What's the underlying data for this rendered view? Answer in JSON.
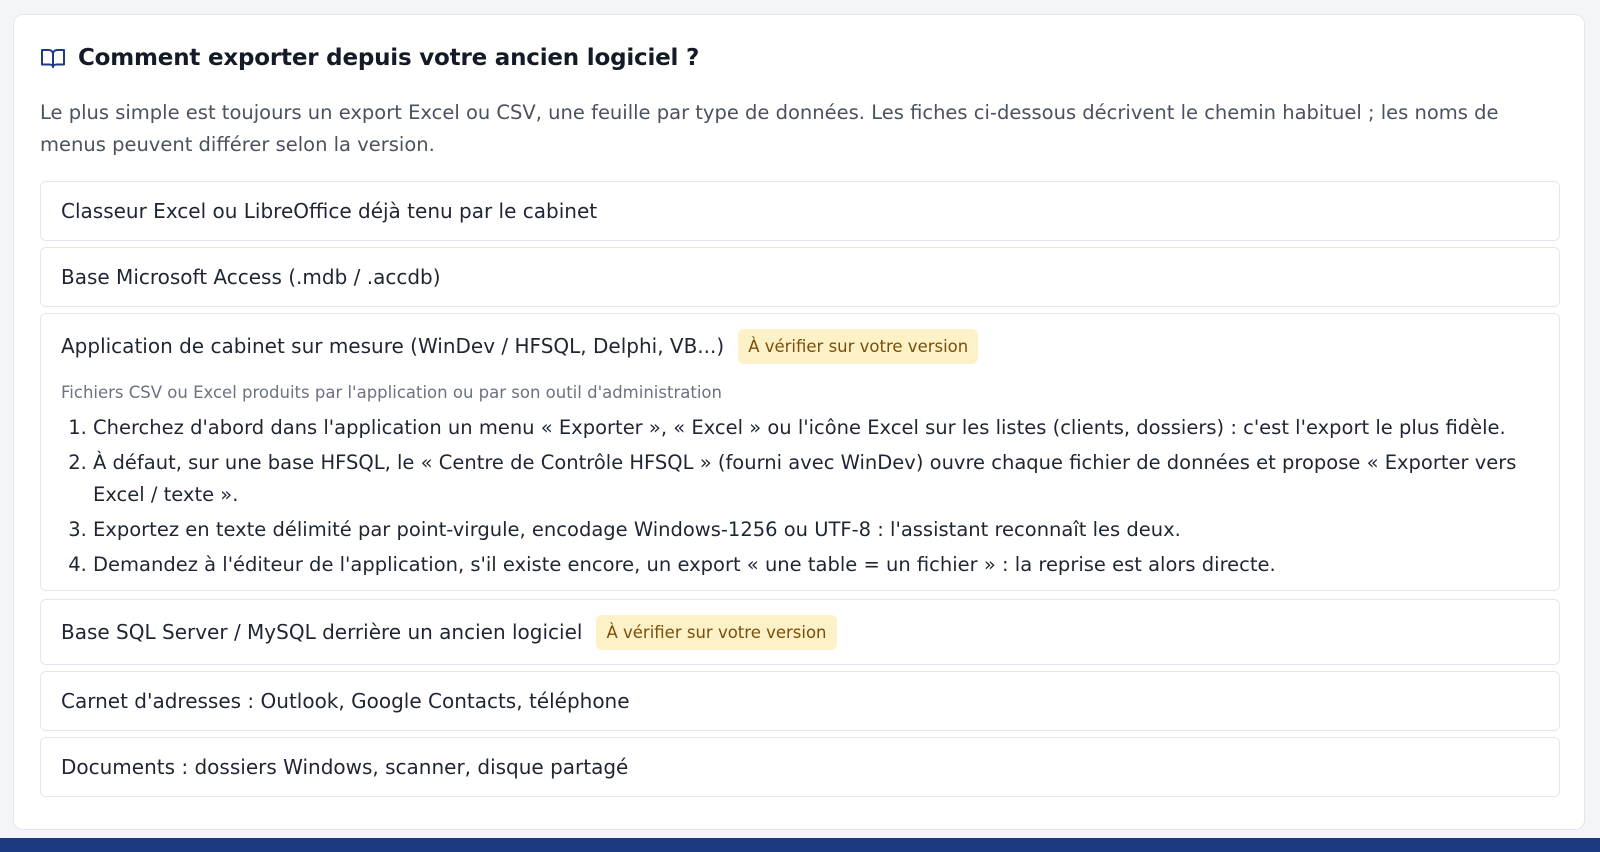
{
  "header": {
    "icon": "book-open-icon",
    "title": "Comment exporter depuis votre ancien logiciel ?"
  },
  "intro": "Le plus simple est toujours un export Excel ou CSV, une feuille par type de données. Les fiches ci-dessous décrivent le chemin habituel ; les noms de menus peuvent différer selon la version.",
  "accordion": [
    {
      "title": "Classeur Excel ou LibreOffice déjà tenu par le cabinet"
    },
    {
      "title": "Base Microsoft Access (.mdb / .accdb)"
    },
    {
      "title": "Application de cabinet sur mesure (WinDev / HFSQL, Delphi, VB...)",
      "badge": "À vérifier sur votre version",
      "subtitle": "Fichiers CSV ou Excel produits par l'application ou par son outil d'administration",
      "steps": [
        "Cherchez d'abord dans l'application un menu « Exporter », « Excel » ou l'icône Excel sur les listes (clients, dossiers) : c'est l'export le plus fidèle.",
        "À défaut, sur une base HFSQL, le « Centre de Contrôle HFSQL » (fourni avec WinDev) ouvre chaque fichier de données et propose « Exporter vers Excel / texte ».",
        "Exportez en texte délimité par point-virgule, encodage Windows-1256 ou UTF-8 : l'assistant reconnaît les deux.",
        "Demandez à l'éditeur de l'application, s'il existe encore, un export « une table = un fichier » : la reprise est alors directe."
      ]
    },
    {
      "title": "Base SQL Server / MySQL derrière un ancien logiciel",
      "badge": "À vérifier sur votre version"
    },
    {
      "title": "Carnet d'adresses : Outlook, Google Contacts, téléphone"
    },
    {
      "title": "Documents : dossiers Windows, scanner, disque partagé"
    }
  ],
  "colors": {
    "accent": "#1e3a8a",
    "badge_bg": "#fdf1c7",
    "badge_text": "#7a4e0b",
    "border": "#e3e7ec"
  }
}
